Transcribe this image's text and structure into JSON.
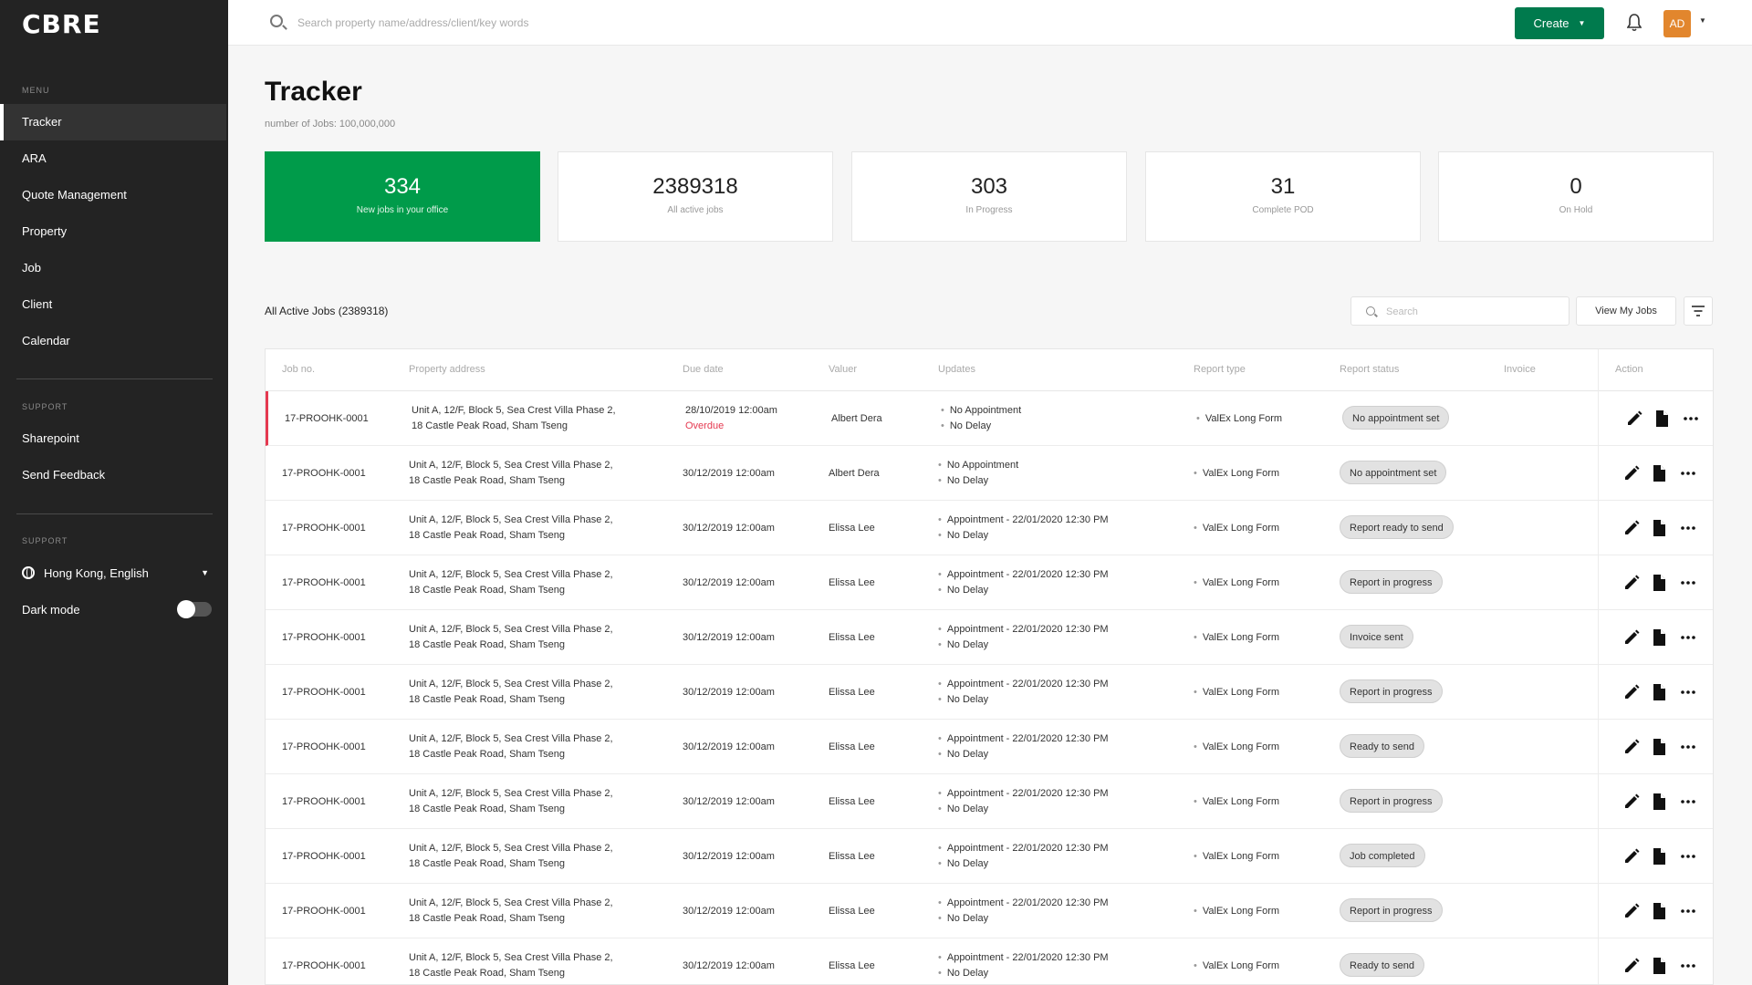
{
  "brand": {
    "logo": "CBRE",
    "accent": "#009b4a",
    "create_color": "#007a4d",
    "overdue_color": "#e53950"
  },
  "sidebar": {
    "menu_heading": "MENU",
    "items": [
      {
        "label": "Tracker",
        "active": true
      },
      {
        "label": "ARA"
      },
      {
        "label": "Quote Management"
      },
      {
        "label": "Property"
      },
      {
        "label": "Job"
      },
      {
        "label": "Client"
      },
      {
        "label": "Calendar"
      }
    ],
    "support_heading": "SUPPORT",
    "support_items": [
      {
        "label": "Sharepoint"
      },
      {
        "label": "Send Feedback"
      }
    ],
    "support_heading_2": "SUPPORT",
    "language": "Hong Kong, English",
    "dark_mode_label": "Dark mode",
    "dark_mode_on": false
  },
  "topbar": {
    "search_placeholder": "Search property name/address/client/key words",
    "create_label": "Create",
    "avatar_initials": "AD"
  },
  "header": {
    "title": "Tracker",
    "subtitle": "number of Jobs: 100,000,000"
  },
  "stats": [
    {
      "value": "334",
      "label": "New jobs in your office"
    },
    {
      "value": "2389318",
      "label": "All active jobs"
    },
    {
      "value": "303",
      "label": "In Progress"
    },
    {
      "value": "31",
      "label": "Complete POD"
    },
    {
      "value": "0",
      "label": "On Hold"
    }
  ],
  "table": {
    "title": "All Active Jobs (2389318)",
    "search_placeholder": "Search",
    "view_my_jobs_label": "View My Jobs",
    "columns": [
      "Job no.",
      "Property address",
      "Due date",
      "Valuer",
      "Updates",
      "Report type",
      "Report status",
      "Invoice",
      "Action"
    ],
    "rows": [
      {
        "job": "17-PROOHK-0001",
        "addr1": "Unit A, 12/F, Block 5, Sea Crest Villa Phase 2,",
        "addr2": "18 Castle Peak Road, Sham Tseng",
        "due": "28/10/2019 12:00am",
        "due_note": "Overdue",
        "valuer": "Albert Dera",
        "upd1": "No Appointment",
        "upd2": "No Delay",
        "type": "ValEx Long Form",
        "status": "No appointment set"
      },
      {
        "job": "17-PROOHK-0001",
        "addr1": "Unit A, 12/F, Block 5, Sea Crest Villa Phase 2,",
        "addr2": "18 Castle Peak Road, Sham Tseng",
        "due": "30/12/2019 12:00am",
        "due_note": "",
        "valuer": "Albert Dera",
        "upd1": "No Appointment",
        "upd2": "No Delay",
        "type": "ValEx Long Form",
        "status": "No appointment set"
      },
      {
        "job": "17-PROOHK-0001",
        "addr1": "Unit A, 12/F, Block 5, Sea Crest Villa Phase 2,",
        "addr2": "18 Castle Peak Road, Sham Tseng",
        "due": "30/12/2019 12:00am",
        "due_note": "",
        "valuer": "Elissa Lee",
        "upd1": "Appointment - 22/01/2020 12:30 PM",
        "upd2": "No Delay",
        "type": "ValEx Long Form",
        "status": "Report ready to send"
      },
      {
        "job": "17-PROOHK-0001",
        "addr1": "Unit A, 12/F, Block 5, Sea Crest Villa Phase 2,",
        "addr2": "18 Castle Peak Road, Sham Tseng",
        "due": "30/12/2019 12:00am",
        "due_note": "",
        "valuer": "Elissa Lee",
        "upd1": "Appointment - 22/01/2020 12:30 PM",
        "upd2": "No Delay",
        "type": "ValEx Long Form",
        "status": "Report in progress"
      },
      {
        "job": "17-PROOHK-0001",
        "addr1": "Unit A, 12/F, Block 5, Sea Crest Villa Phase 2,",
        "addr2": "18 Castle Peak Road, Sham Tseng",
        "due": "30/12/2019 12:00am",
        "due_note": "",
        "valuer": "Elissa Lee",
        "upd1": "Appointment - 22/01/2020 12:30 PM",
        "upd2": "No Delay",
        "type": "ValEx Long Form",
        "status": "Invoice sent"
      },
      {
        "job": "17-PROOHK-0001",
        "addr1": "Unit A, 12/F, Block 5, Sea Crest Villa Phase 2,",
        "addr2": "18 Castle Peak Road, Sham Tseng",
        "due": "30/12/2019 12:00am",
        "due_note": "",
        "valuer": "Elissa Lee",
        "upd1": "Appointment - 22/01/2020 12:30 PM",
        "upd2": "No Delay",
        "type": "ValEx Long Form",
        "status": "Report in progress"
      },
      {
        "job": "17-PROOHK-0001",
        "addr1": "Unit A, 12/F, Block 5, Sea Crest Villa Phase 2,",
        "addr2": "18 Castle Peak Road, Sham Tseng",
        "due": "30/12/2019 12:00am",
        "due_note": "",
        "valuer": "Elissa Lee",
        "upd1": "Appointment - 22/01/2020 12:30 PM",
        "upd2": "No Delay",
        "type": "ValEx Long Form",
        "status": "Ready to send"
      },
      {
        "job": "17-PROOHK-0001",
        "addr1": "Unit A, 12/F, Block 5, Sea Crest Villa Phase 2,",
        "addr2": "18 Castle Peak Road, Sham Tseng",
        "due": "30/12/2019 12:00am",
        "due_note": "",
        "valuer": "Elissa Lee",
        "upd1": "Appointment - 22/01/2020 12:30 PM",
        "upd2": "No Delay",
        "type": "ValEx Long Form",
        "status": "Report in progress"
      },
      {
        "job": "17-PROOHK-0001",
        "addr1": "Unit A, 12/F, Block 5, Sea Crest Villa Phase 2,",
        "addr2": "18 Castle Peak Road, Sham Tseng",
        "due": "30/12/2019 12:00am",
        "due_note": "",
        "valuer": "Elissa Lee",
        "upd1": "Appointment - 22/01/2020 12:30 PM",
        "upd2": "No Delay",
        "type": "ValEx Long Form",
        "status": "Job completed"
      },
      {
        "job": "17-PROOHK-0001",
        "addr1": "Unit A, 12/F, Block 5, Sea Crest Villa Phase 2,",
        "addr2": "18 Castle Peak Road, Sham Tseng",
        "due": "30/12/2019 12:00am",
        "due_note": "",
        "valuer": "Elissa Lee",
        "upd1": "Appointment - 22/01/2020 12:30 PM",
        "upd2": "No Delay",
        "type": "ValEx Long Form",
        "status": "Report in progress"
      },
      {
        "job": "17-PROOHK-0001",
        "addr1": "Unit A, 12/F, Block 5, Sea Crest Villa Phase 2,",
        "addr2": "18 Castle Peak Road, Sham Tseng",
        "due": "30/12/2019 12:00am",
        "due_note": "",
        "valuer": "Elissa Lee",
        "upd1": "Appointment - 22/01/2020 12:30 PM",
        "upd2": "No Delay",
        "type": "ValEx Long Form",
        "status": "Ready to send"
      }
    ]
  }
}
